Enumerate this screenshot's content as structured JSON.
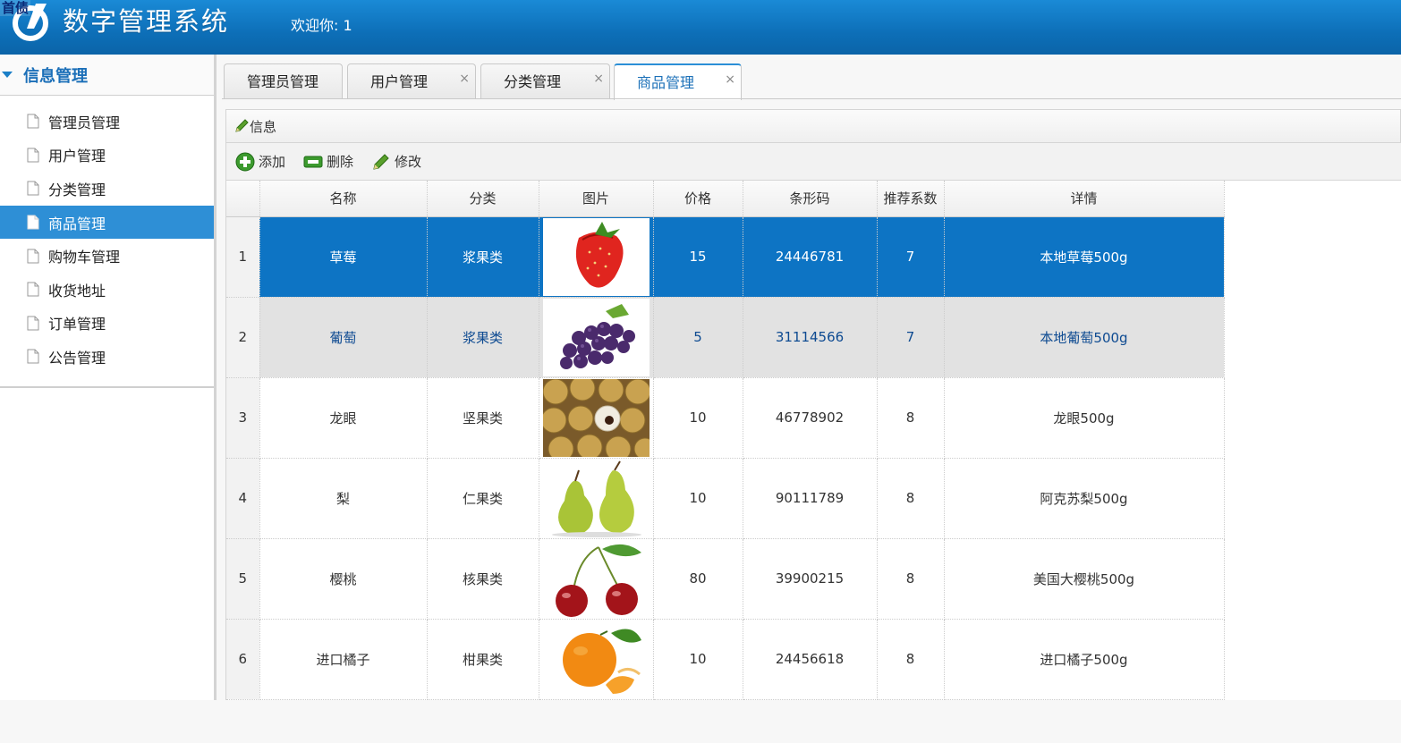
{
  "header": {
    "corner_text": "首债",
    "app_title": "数字管理系统",
    "welcome": "欢迎你: 1"
  },
  "sidebar": {
    "section_title": "信息管理",
    "items": [
      {
        "label": "管理员管理",
        "active": false
      },
      {
        "label": "用户管理",
        "active": false
      },
      {
        "label": "分类管理",
        "active": false
      },
      {
        "label": "商品管理",
        "active": true
      },
      {
        "label": "购物车管理",
        "active": false
      },
      {
        "label": "收货地址",
        "active": false
      },
      {
        "label": "订单管理",
        "active": false
      },
      {
        "label": "公告管理",
        "active": false
      }
    ]
  },
  "tabs": [
    {
      "label": "管理员管理",
      "closable": false,
      "active": false
    },
    {
      "label": "用户管理",
      "closable": true,
      "active": false
    },
    {
      "label": "分类管理",
      "closable": true,
      "active": false
    },
    {
      "label": "商品管理",
      "closable": true,
      "active": true
    }
  ],
  "panel": {
    "title": "信息"
  },
  "toolbar": {
    "add_label": "添加",
    "delete_label": "删除",
    "edit_label": "修改"
  },
  "table": {
    "columns": [
      "名称",
      "分类",
      "图片",
      "价格",
      "条形码",
      "推荐系数",
      "详情"
    ],
    "rows": [
      {
        "no": "1",
        "name": "草莓",
        "category": "浆果类",
        "image": "strawberry",
        "price": "15",
        "barcode": "24446781",
        "score": "7",
        "detail": "本地草莓500g",
        "state": "selected"
      },
      {
        "no": "2",
        "name": "葡萄",
        "category": "浆果类",
        "image": "grapes",
        "price": "5",
        "barcode": "31114566",
        "score": "7",
        "detail": "本地葡萄500g",
        "state": "hover"
      },
      {
        "no": "3",
        "name": "龙眼",
        "category": "坚果类",
        "image": "longan",
        "price": "10",
        "barcode": "46778902",
        "score": "8",
        "detail": "龙眼500g",
        "state": ""
      },
      {
        "no": "4",
        "name": "梨",
        "category": "仁果类",
        "image": "pear",
        "price": "10",
        "barcode": "90111789",
        "score": "8",
        "detail": "阿克苏梨500g",
        "state": ""
      },
      {
        "no": "5",
        "name": "樱桃",
        "category": "核果类",
        "image": "cherry",
        "price": "80",
        "barcode": "39900215",
        "score": "8",
        "detail": "美国大樱桃500g",
        "state": ""
      },
      {
        "no": "6",
        "name": "进口橘子",
        "category": "柑果类",
        "image": "orange",
        "price": "10",
        "barcode": "24456618",
        "score": "8",
        "detail": "进口橘子500g",
        "state": ""
      }
    ]
  },
  "colors": {
    "header_blue": "#0d6fb8",
    "active_blue": "#2e8fd6",
    "selected_row": "#0d74c4",
    "hover_row": "#e2e2e2"
  }
}
